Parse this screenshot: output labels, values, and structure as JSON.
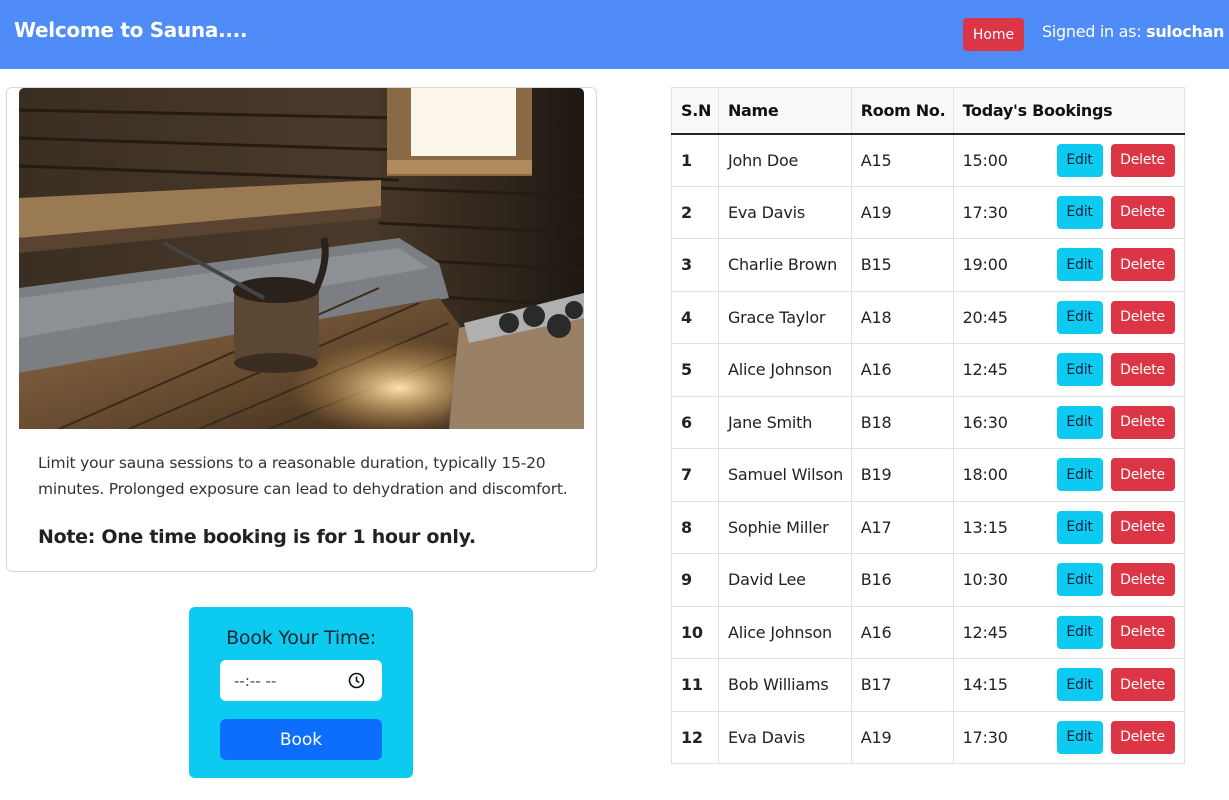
{
  "header": {
    "brand": "Welcome to Sauna....",
    "home_label": "Home",
    "signed_prefix": "Signed in as:",
    "username": "sulochan",
    "bg_color": "#4f8cf7"
  },
  "card": {
    "text": "Limit your sauna sessions to a reasonable duration, typically 15-20 minutes. Prolonged exposure can lead to dehydration and discomfort.",
    "note": "Note: One time booking is for 1 hour only."
  },
  "booking": {
    "title": "Book Your Time:",
    "time_placeholder": "--:-- --",
    "book_label": "Book",
    "clock_icon": "clock-icon"
  },
  "table": {
    "headers": [
      "S.N",
      "Name",
      "Room No.",
      "Today's Bookings"
    ],
    "edit_label": "Edit",
    "delete_label": "Delete",
    "rows": [
      {
        "sn": "1",
        "name": "John Doe",
        "room": "A15",
        "time": "15:00"
      },
      {
        "sn": "2",
        "name": "Eva Davis",
        "room": "A19",
        "time": "17:30"
      },
      {
        "sn": "3",
        "name": "Charlie Brown",
        "room": "B15",
        "time": "19:00"
      },
      {
        "sn": "4",
        "name": "Grace Taylor",
        "room": "A18",
        "time": "20:45"
      },
      {
        "sn": "5",
        "name": "Alice Johnson",
        "room": "A16",
        "time": "12:45"
      },
      {
        "sn": "6",
        "name": "Jane Smith",
        "room": "B18",
        "time": "16:30"
      },
      {
        "sn": "7",
        "name": "Samuel Wilson",
        "room": "B19",
        "time": "18:00"
      },
      {
        "sn": "8",
        "name": "Sophie Miller",
        "room": "A17",
        "time": "13:15"
      },
      {
        "sn": "9",
        "name": "David Lee",
        "room": "B16",
        "time": "10:30"
      },
      {
        "sn": "10",
        "name": "Alice Johnson",
        "room": "A16",
        "time": "12:45"
      },
      {
        "sn": "11",
        "name": "Bob Williams",
        "room": "B17",
        "time": "14:15"
      },
      {
        "sn": "12",
        "name": "Eva Davis",
        "room": "A19",
        "time": "17:30"
      }
    ]
  }
}
